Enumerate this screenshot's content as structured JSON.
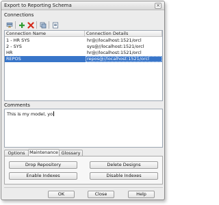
{
  "window": {
    "title": "Export to Reporting Schema",
    "close_glyph": "×"
  },
  "connections_label": "Connections",
  "toolbar": {
    "icons": [
      "edit-connection-icon",
      "add-connection-icon",
      "delete-connection-icon",
      "copy-connection-icon",
      "properties-icon"
    ],
    "colors": {
      "add": "#2e9a2e",
      "delete": "#d42a1a"
    }
  },
  "table": {
    "columns": [
      "Connection Name",
      "Connection Details"
    ],
    "rows": [
      {
        "name": "1 - HR SYS",
        "details": "hr@//localhost:1521/orcl"
      },
      {
        "name": "2 - SYS",
        "details": "sys@//localhost:1521/orcl"
      },
      {
        "name": "HR",
        "details": "hr@//localhost:1521/orcl"
      },
      {
        "name": "REPOS",
        "details": "repos@//localhost:1521/orcl"
      }
    ],
    "selected_row": "REPOS",
    "selection_color": "#3875c9"
  },
  "comments": {
    "label": "Comments",
    "value": "This is my model, yo"
  },
  "tabs": {
    "options": "Options",
    "maintenance": "Maintenance",
    "glossary": "Glossary",
    "active": "Maintenance"
  },
  "maintenance": {
    "drop_repository": "Drop Repository",
    "delete_designs": "Delete Designs",
    "enable_indexes": "Enable Indexes",
    "disable_indexes": "Disable Indexes"
  },
  "footer": {
    "ok": "OK",
    "close": "Close",
    "help": "Help"
  }
}
